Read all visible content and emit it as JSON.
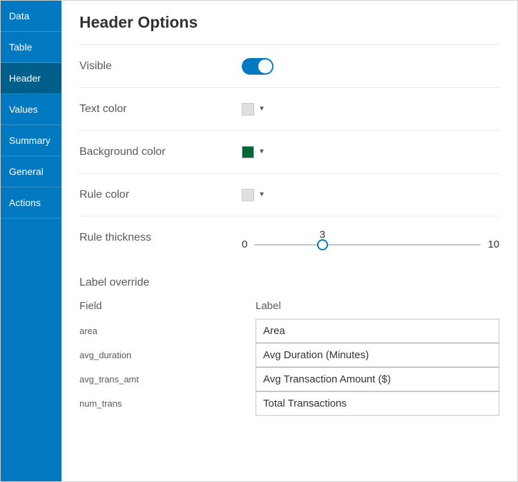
{
  "sidebar": {
    "items": [
      {
        "label": "Data"
      },
      {
        "label": "Table"
      },
      {
        "label": "Header"
      },
      {
        "label": "Values"
      },
      {
        "label": "Summary"
      },
      {
        "label": "General"
      },
      {
        "label": "Actions"
      }
    ],
    "active_index": 2
  },
  "header": {
    "title": "Header Options"
  },
  "options": {
    "visible": {
      "label": "Visible",
      "value": true
    },
    "text_color": {
      "label": "Text color",
      "value": "#e0e0e0"
    },
    "background_color": {
      "label": "Background color",
      "value": "#006837"
    },
    "rule_color": {
      "label": "Rule color",
      "value": "#e0e0e0"
    },
    "rule_thickness": {
      "label": "Rule thickness",
      "min": 0,
      "max": 10,
      "value": 3
    }
  },
  "label_override": {
    "title": "Label override",
    "field_header": "Field",
    "label_header": "Label",
    "rows": [
      {
        "field": "area",
        "label": "Area"
      },
      {
        "field": "avg_duration",
        "label": "Avg Duration (Minutes)"
      },
      {
        "field": "avg_trans_amt",
        "label": "Avg Transaction Amount ($)"
      },
      {
        "field": "num_trans",
        "label": "Total Transactions"
      }
    ]
  }
}
